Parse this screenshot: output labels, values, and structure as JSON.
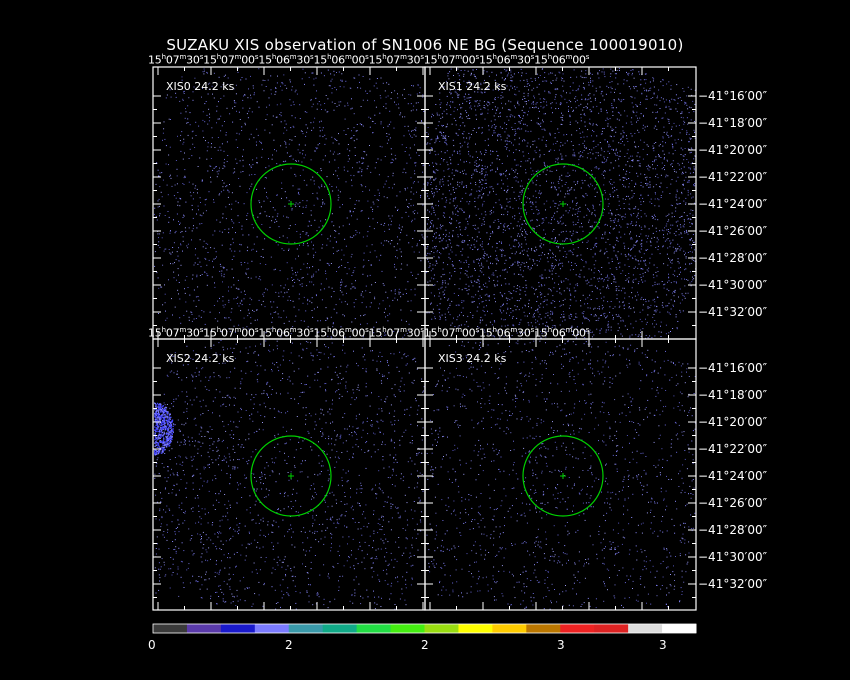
{
  "title": "SUZAKU XIS observation of SN1006 NE BG  (Sequence 100019010)",
  "ra_labels": [
    "15h07m30s",
    "15h07m00s",
    "15h06m30s",
    "15h06m00s"
  ],
  "ra_labels_display": [
    {
      "h": "15",
      "m": "07",
      "s": "30"
    },
    {
      "h": "15",
      "m": "07",
      "s": "00"
    },
    {
      "h": "15",
      "m": "06",
      "s": "30"
    },
    {
      "h": "15",
      "m": "06",
      "s": "00"
    }
  ],
  "dec_labels": [
    "−41°16′00″",
    "−41°18′00″",
    "−41°20′00″",
    "−41°22′00″",
    "−41°24′00″",
    "−41°26′00″",
    "−41°28′00″",
    "−41°30′00″",
    "−41°32′00″"
  ],
  "panels": [
    {
      "id": "xis0",
      "label": "XIS0 24.2 ks"
    },
    {
      "id": "xis1",
      "label": "XIS1 24.2 ks"
    },
    {
      "id": "xis2",
      "label": "XIS2 24.2 ks"
    },
    {
      "id": "xis3",
      "label": "XIS3 24.2 ks"
    }
  ],
  "colors": {
    "region_circle": "#00d000",
    "frame": "#ffffff",
    "events": "#8a8aff"
  },
  "colorbar": {
    "colors": [
      "#3a3a3a",
      "#5a3aaa",
      "#1a1acc",
      "#7b7bff",
      "#3a9aaa",
      "#11aa88",
      "#22dd44",
      "#44ee11",
      "#99dd11",
      "#ffff00",
      "#ffcc00",
      "#bb7700",
      "#ee2222",
      "#dd2222",
      "#dddddd",
      "#ffffff"
    ],
    "ticks": [
      "0",
      "2",
      "2",
      "3",
      "3"
    ]
  }
}
